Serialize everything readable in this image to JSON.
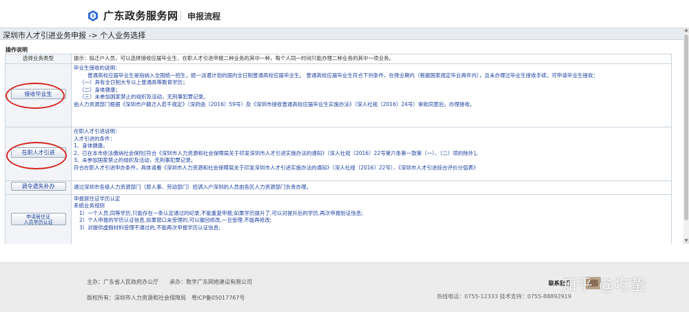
{
  "header": {
    "site_name": "广东政务服务网",
    "page_label": "申报流程"
  },
  "breadcrumb": "深圳市人才引进业务申报 -> 个人业务选择",
  "section_title": "操作说明",
  "table": {
    "head_left": "选择业务类型",
    "head_right": "提示：拟迁户人员，可以选择接收应届毕业生、在职人才引进申报二种业务的其中一种，每个人同一时间只能办理二种业务的其中一项业务。",
    "rows": [
      {
        "button": "接收毕业生",
        "lines": [
          "毕业生接收的说明：",
          "普通高校应届毕业生是指纳入全国统一招生，统一派遣计划的国内全日制普通高校应届毕业生。 普通高校应届毕业生符合下列条件，在择业期内（根据国家规定毕业两年内），且未办理过毕业生接收手续，可申请毕业生接收：",
          "（一）具有全日制大专以上普通高等教育学历；",
          "（二）身体健康；",
          "（三）未参加国家禁止的组织及活动，无刑事犯罪记录。",
          "由人力资源部门根据《深圳市户籍迁入若干规定》（深府函〔2016〕59号）及《深圳市接收普通高校应届毕业生实施办法》（深人社规〔2016〕24号）审批同意后，办理接收。"
        ]
      },
      {
        "button": "在职人才引进",
        "lines": [
          "在职人才引进说明：",
          "人才引进的条件：",
          "1、身体健康。",
          "2、已在本市依法缴纳社会保险[符合《深圳市人力资源和社会保障局关于印发深圳市人才引进实施办法的通知》（深人社规〔2016〕22号第六条第一款第（一）、（二）项的除外]。",
          "3、未参加国家禁止的组织及活动，无刑事犯罪记录。",
          "符合在职人才引进申办条件，具体请看《深圳市人力资源和社会保障局关于印发深圳市人才引进实施办法的通知》（深人社规〔2016〕22号）、《深圳市人才引进综合评价分值表》"
        ]
      },
      {
        "button": "调令遗失补办",
        "lines": [
          "通过深圳市各级人力资源部门（原人事、劳动部门）招调入户深圳的人员由各区人力资源部门负责办理。"
        ]
      },
      {
        "button": "申请居住证\n人员学历认证",
        "lines": [
          "申报居住证学历认定",
          "系统业务规则",
          "1）一个人员,同等学历,只能存在一条认定通过的纪录,不能重复申报;如果学历提升了,可以对提升后的学历,再次申报验证信息;",
          "2）个人申报的学历认证信息,如果窗口未受理的,可以撤回修改,一旦受理,不能再修改;",
          "3）对提供虚假材料受理不通过的,不能再次申报学历认证信息;"
        ]
      }
    ]
  },
  "footer": {
    "line1": "主办：广东省人民政府办公厅　　承办：数字广东网络建设有限公司",
    "line2": "版权所有：深圳市人力资源和社会保障局　粤ICP备05017767号",
    "contact_label": "联系我们",
    "hotline": "热线电话：0755-12333 技术支持：0755-88892919",
    "watermark": "知乎 @圪蛰"
  },
  "colors": {
    "link_blue": "#1b3fa0",
    "annotation_red": "#d7261f",
    "logo_blue": "#2f6bd6"
  }
}
